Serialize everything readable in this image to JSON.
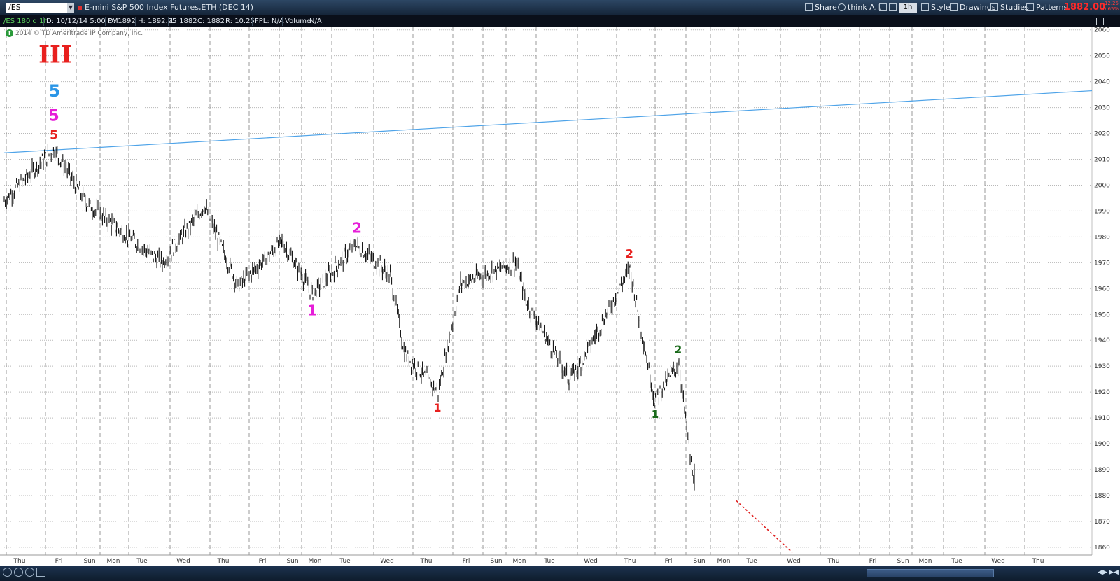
{
  "toolbar": {
    "symbol": "/ES",
    "description": "E-mini S&P 500 Index Futures,ETH (DEC 14)",
    "share": "Share",
    "think": "think A.I.",
    "timeframe": "1h",
    "style": "Style",
    "drawings": "Drawings",
    "studies": "Studies",
    "patterns": "Patterns",
    "last_price": "1882.00",
    "change": "-12.25",
    "change_pct": "-0.65%"
  },
  "infobar": {
    "chart_id": "/ES 180 d 1h",
    "date": "D: 10/12/14 5:00 PM",
    "open": "O: 1892",
    "high": "H: 1892.25",
    "low": "L: 1882",
    "close": "C: 1882",
    "range": "R: 10.25",
    "fpl": "FPL: N/A",
    "volume": "Volume",
    "volume_value": "N/A"
  },
  "copyright": "2014 © TD Ameritrade IP Company, Inc.",
  "colors": {
    "red": "#e8201e",
    "magenta": "#e61ed8",
    "blue": "#2a95e6",
    "green": "#1a6a1a",
    "trendline": "#4ea3e8",
    "price_bars": "#000000"
  },
  "chart_data": {
    "type": "ohlc",
    "bar_interval": "1h",
    "ylim": [
      1857,
      2061
    ],
    "y_ticks": [
      1860,
      1870,
      1880,
      1890,
      1900,
      1910,
      1920,
      1930,
      1940,
      1950,
      1960,
      1970,
      1980,
      1990,
      2000,
      2010,
      2020,
      2030,
      2040,
      2050,
      2060
    ],
    "x_labels": [
      "Thu",
      "Fri",
      "Sun",
      "Mon",
      "Tue",
      "Wed",
      "Thu",
      "Fri",
      "Sun",
      "Mon",
      "Tue",
      "Wed",
      "Thu",
      "Fri",
      "Sun",
      "Mon",
      "Tue",
      "Wed",
      "Thu",
      "Fri",
      "Sun",
      "Mon",
      "Tue",
      "Wed",
      "Thu",
      "Fri",
      "Sun",
      "Mon",
      "Tue",
      "Wed",
      "Thu"
    ],
    "price_path_approx": [
      {
        "session": 0,
        "value": 1994
      },
      {
        "session": 1,
        "value": 2014
      },
      {
        "session": 2,
        "value": 1993
      },
      {
        "session": 3,
        "value": 1985
      },
      {
        "session": 4,
        "value": 1970
      },
      {
        "session": 5,
        "value": 1992
      },
      {
        "session": 6,
        "value": 1961
      },
      {
        "session": 7,
        "value": 1978
      },
      {
        "session": 8,
        "value": 1958
      },
      {
        "session": 9,
        "value": 1977
      },
      {
        "session": 10,
        "value": 1965
      },
      {
        "session": 11,
        "value": 1935
      },
      {
        "session": 12,
        "value": 1920
      },
      {
        "session": 13,
        "value": 1962
      },
      {
        "session": 14,
        "value": 1970
      },
      {
        "session": 15,
        "value": 1955
      },
      {
        "session": 16,
        "value": 1925
      },
      {
        "session": 17,
        "value": 1931
      },
      {
        "session": 18,
        "value": 1968
      },
      {
        "session": 19,
        "value": 1917
      },
      {
        "session": 20,
        "value": 1931
      },
      {
        "session": 21,
        "value": 1882
      }
    ],
    "trendline": {
      "start_value": 2012.5,
      "end_value": 2036.5
    },
    "projection_line": {
      "start_value": 1878,
      "end_value": 1858,
      "style": "dotted"
    },
    "wave_labels": [
      {
        "text": "III",
        "color": "red",
        "value": 2050.5,
        "at": "Fri"
      },
      {
        "text": "5",
        "color": "blue",
        "value": 2036.5,
        "at": "Fri"
      },
      {
        "text": "5",
        "color": "magenta",
        "value": 2027,
        "at": "Fri"
      },
      {
        "text": "5",
        "color": "red",
        "value": 2019.5,
        "at": "Fri"
      },
      {
        "text": "2",
        "color": "magenta",
        "value": 1983.5,
        "at": "Tue"
      },
      {
        "text": "1",
        "color": "magenta",
        "value": 1951.5,
        "at": "Mon"
      },
      {
        "text": "1",
        "color": "red",
        "value": 1914,
        "at": "Thu"
      },
      {
        "text": "2",
        "color": "red",
        "value": 1973.5,
        "at": "Thu"
      },
      {
        "text": "2",
        "color": "green",
        "value": 1936.5,
        "at": "Thu"
      },
      {
        "text": "1",
        "color": "green",
        "value": 1911.5,
        "at": "Fri"
      }
    ]
  }
}
